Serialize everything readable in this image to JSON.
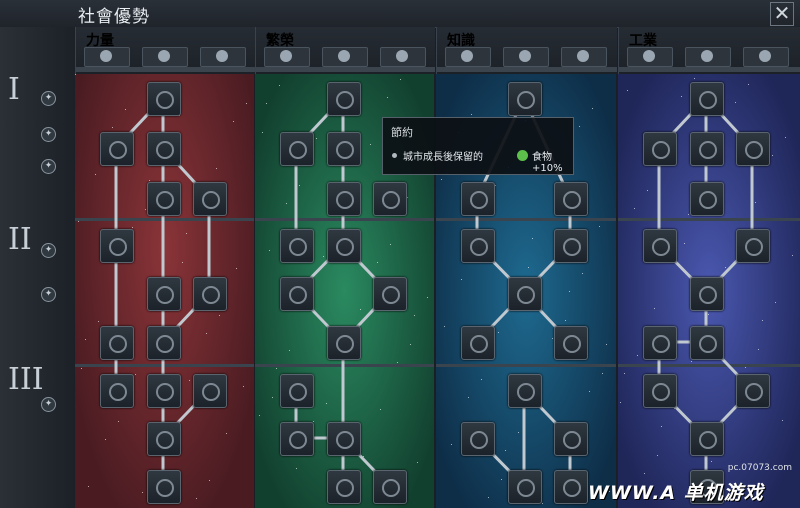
{
  "window": {
    "title": "社會優勢",
    "close_label": "✕"
  },
  "tiers": [
    {
      "label": "I",
      "buttons": 3
    },
    {
      "label": "II",
      "buttons": 2
    },
    {
      "label": "III",
      "buttons": 1
    }
  ],
  "columns": [
    {
      "name": "力量",
      "name_color": "#e8943a",
      "bg_color": "#7a2c30",
      "accent": "#c05050",
      "icons": [
        "muscle-icon",
        "shield-icon",
        "fist-icon"
      ]
    },
    {
      "name": "繁榮",
      "name_color": "#5fd26b",
      "bg_color": "#1e6b52",
      "accent": "#40b880",
      "icons": [
        "leaf-icon",
        "sprout-icon",
        "wheat-icon"
      ]
    },
    {
      "name": "知識",
      "name_color": "#52b8e8",
      "bg_color": "#1a5878",
      "accent": "#40a0d0",
      "icons": [
        "scholar-icon",
        "bulb-icon",
        "book-icon"
      ]
    },
    {
      "name": "工業",
      "name_color": "#a9b6ff",
      "bg_color": "#3b4a98",
      "accent": "#6c7ad0",
      "icons": [
        "gear-icon",
        "box-icon",
        "anvil-icon"
      ]
    }
  ],
  "tooltip": {
    "title": "節約",
    "effect_text": "城市成長後保留的",
    "resource_icon": "food-icon",
    "resource_label": "食物",
    "value": "+10%"
  },
  "watermark": {
    "site": "pc.07073.com",
    "brand": "WWW.A 单机游戏"
  }
}
